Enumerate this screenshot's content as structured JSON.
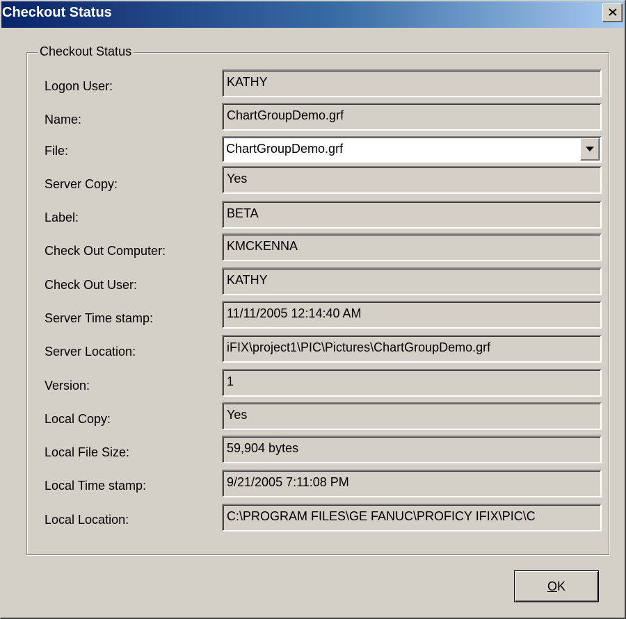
{
  "window": {
    "title": "Checkout Status",
    "close_glyph": "×"
  },
  "group": {
    "legend": "Checkout Status"
  },
  "fields": [
    {
      "label": "Logon User:",
      "value": "KATHY"
    },
    {
      "label": "Name:",
      "value": "ChartGroupDemo.grf"
    },
    {
      "label": "File:",
      "value": "ChartGroupDemo.grf"
    },
    {
      "label": "Server Copy:",
      "value": "Yes"
    },
    {
      "label": "Label:",
      "value": "BETA"
    },
    {
      "label": "Check Out Computer:",
      "value": "KMCKENNA"
    },
    {
      "label": "Check Out User:",
      "value": "KATHY"
    },
    {
      "label": "Server Time stamp:",
      "value": "11/11/2005 12:14:40 AM"
    },
    {
      "label": "Server Location:",
      "value": "iFIX\\project1\\PIC\\Pictures\\ChartGroupDemo.grf"
    },
    {
      "label": "Version:",
      "value": "1"
    },
    {
      "label": "Local Copy:",
      "value": "Yes"
    },
    {
      "label": "Local File Size:",
      "value": "59,904 bytes"
    },
    {
      "label": "Local Time stamp:",
      "value": "9/21/2005 7:11:08 PM"
    },
    {
      "label": "Local Location:",
      "value": "C:\\PROGRAM FILES\\GE FANUC\\PROFICY IFIX\\PIC\\C"
    }
  ],
  "buttons": {
    "ok_mnemonic": "O",
    "ok_rest": "K"
  },
  "icons": {
    "close": "close-icon",
    "dropdown": "chevron-down-icon"
  },
  "colors": {
    "titlebar_start": "#0a246a",
    "titlebar_end": "#a6caf0",
    "face": "#d4d0c8"
  }
}
